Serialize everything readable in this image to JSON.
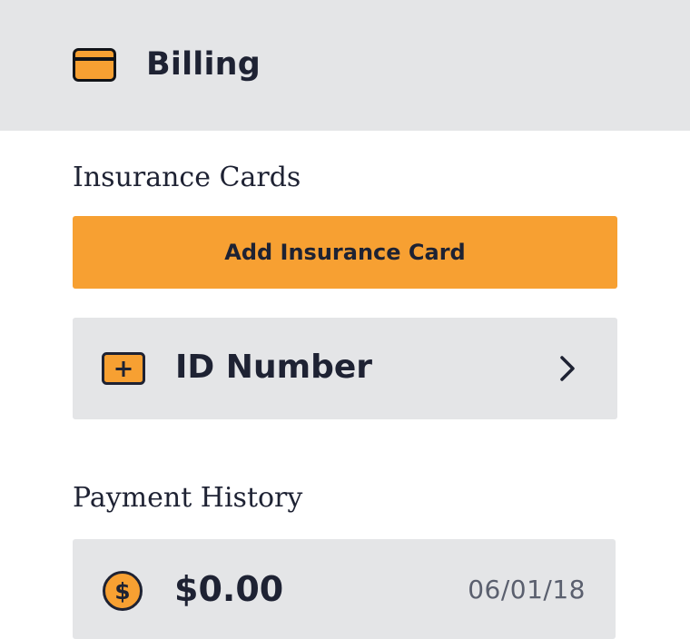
{
  "header": {
    "title": "Billing",
    "icon": "credit-card-icon",
    "background": "#e4e5e7"
  },
  "insurance": {
    "section_title": "Insurance Cards",
    "add_button_label": "Add Insurance Card",
    "cards": [
      {
        "label": "ID Number",
        "icon": "insurance-card-icon"
      }
    ]
  },
  "payments": {
    "section_title": "Payment History",
    "items": [
      {
        "amount": "$0.00",
        "date": "06/01/18",
        "icon": "dollar-icon"
      }
    ]
  },
  "colors": {
    "accent": "#f7a032",
    "text": "#1e2233",
    "muted_text": "#5a5f6e",
    "panel": "#e4e5e7"
  }
}
